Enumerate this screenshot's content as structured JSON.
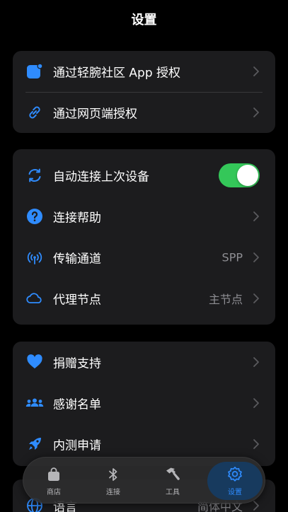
{
  "header": {
    "title": "设置"
  },
  "group1": {
    "items": [
      {
        "label": "通过轻腕社区 App 授权",
        "icon": "square-badge-icon"
      },
      {
        "label": "通过网页端授权",
        "icon": "link-icon"
      }
    ]
  },
  "group2": {
    "items": [
      {
        "label": "自动连接上次设备",
        "icon": "sync-icon",
        "toggle_on": true
      },
      {
        "label": "连接帮助",
        "icon": "question-circle-icon"
      },
      {
        "label": "传输通道",
        "value": "SPP",
        "icon": "antenna-icon"
      },
      {
        "label": "代理节点",
        "value": "主节点",
        "icon": "cloud-icon"
      }
    ]
  },
  "group3": {
    "items": [
      {
        "label": "捐赠支持",
        "icon": "heart-icon"
      },
      {
        "label": "感谢名单",
        "icon": "people-icon"
      },
      {
        "label": "内测申请",
        "icon": "rocket-icon"
      }
    ]
  },
  "group4": {
    "items": [
      {
        "label": "语言",
        "value": "简体中文",
        "icon": "globe-icon"
      }
    ]
  },
  "tabbar": {
    "tabs": [
      {
        "label": "商店",
        "icon": "bag-icon",
        "active": false
      },
      {
        "label": "连接",
        "icon": "bluetooth-icon",
        "active": false
      },
      {
        "label": "工具",
        "icon": "hammer-icon",
        "active": false
      },
      {
        "label": "设置",
        "icon": "gear-icon",
        "active": true
      }
    ]
  },
  "colors": {
    "accent": "#2f8cff",
    "toggle_on": "#34c759",
    "card": "#1c1c1e",
    "background": "#000000",
    "secondary_text": "#8e8e93"
  }
}
